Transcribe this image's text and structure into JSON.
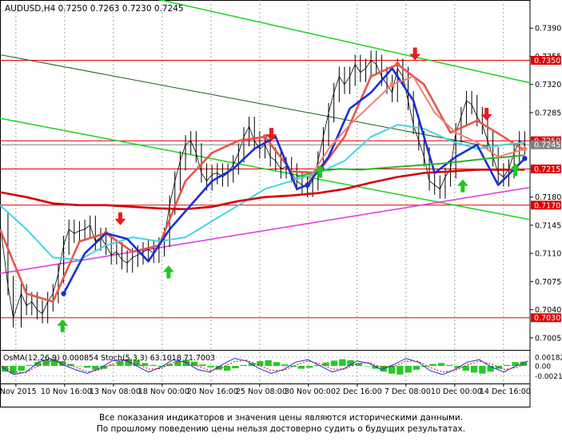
{
  "chart_data": {
    "type": "line",
    "title": "AUDUSD,H4  0.7250 0.7263 0.7230 0.7245",
    "symbol": "AUDUSD,H4",
    "ohlc": [
      "0.7250",
      "0.7263",
      "0.7230",
      "0.7245"
    ],
    "ylim": [
      0.699,
      0.7425
    ],
    "y_ticks": [
      "0.7390",
      "0.7355",
      "0.7320",
      "0.7285",
      "0.7250",
      "0.7215",
      "0.7180",
      "0.7145",
      "0.7110",
      "0.7075",
      "0.7040",
      "0.7005"
    ],
    "x_ticks": [
      "Nov 2015",
      "10 Nov 16:00",
      "13 Nov 08:00",
      "18 Nov 00:00",
      "20 Nov 16:00",
      "25 Nov 08:00",
      "30 Nov 00:00",
      "2 Dec 16:00",
      "7 Dec 08:00",
      "10 Dec 00:00",
      "14 Dec 16:00"
    ],
    "x_range": [
      0,
      100
    ],
    "price_series": {
      "name": "",
      "x": [
        0,
        1.5,
        2.5,
        4,
        5,
        6,
        7,
        8,
        9,
        10,
        11,
        12,
        13,
        14,
        15,
        16,
        17,
        18,
        19,
        20,
        21,
        22,
        23,
        24,
        25,
        26,
        27,
        28,
        29,
        30,
        31,
        32,
        33,
        34,
        35,
        36,
        37,
        38,
        39,
        40,
        41,
        42,
        43,
        44,
        45,
        46,
        47,
        48,
        49,
        50,
        51,
        52,
        53,
        54,
        55,
        56,
        57,
        58,
        59,
        60,
        61,
        62,
        63,
        64,
        65,
        66,
        67,
        68,
        69,
        70,
        71,
        72,
        73,
        74,
        75,
        76,
        77,
        78,
        79,
        80,
        81,
        82,
        83,
        84,
        85,
        86,
        87,
        88,
        89,
        90,
        91,
        92,
        93,
        94,
        95,
        96,
        97,
        98,
        99
      ],
      "y": [
        0.7148,
        0.707,
        0.703,
        0.706,
        0.7045,
        0.705,
        0.704,
        0.7035,
        0.705,
        0.706,
        0.7085,
        0.712,
        0.714,
        0.7135,
        0.7138,
        0.714,
        0.7145,
        0.7125,
        0.713,
        0.712,
        0.7108,
        0.7112,
        0.7102,
        0.7098,
        0.7105,
        0.7108,
        0.7112,
        0.7115,
        0.711,
        0.7118,
        0.713,
        0.717,
        0.72,
        0.7225,
        0.7245,
        0.725,
        0.7235,
        0.721,
        0.72,
        0.7208,
        0.721,
        0.7205,
        0.721,
        0.722,
        0.7235,
        0.7255,
        0.7268,
        0.725,
        0.724,
        0.7245,
        0.723,
        0.7225,
        0.7215,
        0.7218,
        0.721,
        0.72,
        0.7195,
        0.7192,
        0.72,
        0.7225,
        0.7255,
        0.7285,
        0.731,
        0.733,
        0.732,
        0.733,
        0.7345,
        0.7335,
        0.734,
        0.735,
        0.7345,
        0.733,
        0.732,
        0.731,
        0.734,
        0.733,
        0.73,
        0.727,
        0.725,
        0.723,
        0.72,
        0.7195,
        0.719,
        0.7205,
        0.7215,
        0.726,
        0.728,
        0.73,
        0.7295,
        0.728,
        0.727,
        0.725,
        0.723,
        0.721,
        0.7205,
        0.7215,
        0.7235,
        0.725,
        0.7245
      ],
      "color": "#000000"
    },
    "series": [
      {
        "name": "",
        "color": "#e8554a",
        "values_x": [
          0,
          5,
          10,
          15,
          20,
          25,
          30,
          35,
          40,
          45,
          50,
          55,
          60,
          65,
          70,
          75,
          80,
          85,
          90,
          95,
          99
        ],
        "values": [
          0.714,
          0.706,
          0.705,
          0.7125,
          0.7135,
          0.7112,
          0.712,
          0.72,
          0.7235,
          0.725,
          0.7255,
          0.7212,
          0.721,
          0.7255,
          0.733,
          0.7345,
          0.732,
          0.726,
          0.7275,
          0.7255,
          0.7238
        ]
      },
      {
        "name": "",
        "color": "#46d4e0",
        "values_x": [
          0,
          5,
          10,
          15,
          20,
          25,
          30,
          35,
          40,
          45,
          50,
          55,
          60,
          65,
          70,
          75,
          80,
          85,
          90,
          95,
          99
        ],
        "values": [
          0.717,
          0.714,
          0.7105,
          0.7102,
          0.712,
          0.713,
          0.7125,
          0.713,
          0.715,
          0.717,
          0.719,
          0.72,
          0.721,
          0.7225,
          0.7255,
          0.727,
          0.7265,
          0.725,
          0.724,
          0.7245,
          0.7248
        ]
      },
      {
        "name": "",
        "color": "#d40000",
        "values_x": [
          0,
          5,
          10,
          15,
          20,
          25,
          30,
          35,
          40,
          45,
          50,
          55,
          60,
          65,
          70,
          75,
          80,
          85,
          90,
          95,
          99
        ],
        "values": [
          0.7186,
          0.718,
          0.7172,
          0.717,
          0.717,
          0.7168,
          0.7166,
          0.7165,
          0.7168,
          0.7175,
          0.718,
          0.7182,
          0.7185,
          0.719,
          0.7198,
          0.7205,
          0.721,
          0.7212,
          0.7214,
          0.7214,
          0.7214
        ]
      },
      {
        "name": "",
        "color": "#1a2fd0",
        "values_x": [
          12,
          16,
          20,
          24,
          28,
          32,
          36,
          40,
          44,
          48,
          52,
          56,
          58
        ],
        "values": [
          0.706,
          0.711,
          0.7135,
          0.7128,
          0.71,
          0.714,
          0.717,
          0.72,
          0.7215,
          0.724,
          0.7255,
          0.719,
          0.7195
        ]
      },
      {
        "name": "",
        "color": "#1a2fd0",
        "values_x": [
          58,
          62,
          66,
          70,
          74,
          78,
          82,
          86,
          90,
          94,
          99
        ],
        "values": [
          0.7195,
          0.723,
          0.729,
          0.731,
          0.734,
          0.73,
          0.721,
          0.723,
          0.7245,
          0.7195,
          0.7228
        ]
      },
      {
        "name": "",
        "color": "#28b428",
        "values_x": [
          56,
          60,
          64,
          68,
          72,
          76,
          80,
          84,
          88,
          92,
          96,
          99
        ],
        "values": [
          0.7205,
          0.7212,
          0.7215,
          0.7214,
          0.7216,
          0.7218,
          0.722,
          0.7222,
          0.7225,
          0.7228,
          0.723,
          0.7232
        ]
      },
      {
        "name": "",
        "color": "#f08070",
        "values_x": [
          58,
          62,
          66,
          70,
          74,
          78,
          82,
          86,
          90,
          94,
          99
        ],
        "values": [
          0.72,
          0.724,
          0.727,
          0.7295,
          0.732,
          0.733,
          0.7285,
          0.726,
          0.7248,
          0.723,
          0.724
        ]
      }
    ],
    "trend_lines": [
      {
        "name": "",
        "color": "#28d228",
        "from": [
          27,
          0.743
        ],
        "to": [
          100,
          0.7322
        ]
      },
      {
        "name": "",
        "color": "#28d228",
        "from": [
          0,
          0.7278
        ],
        "to": [
          100,
          0.7152
        ]
      },
      {
        "name": "",
        "color": "#1a5c1a",
        "from": [
          0,
          0.7357
        ],
        "to": [
          92,
          0.7243
        ]
      },
      {
        "name": "",
        "color": "#e040e0",
        "from": [
          0,
          0.7085
        ],
        "to": [
          100,
          0.7192
        ]
      }
    ],
    "horizontal_levels": [
      {
        "label": "0.7350",
        "value": 0.735,
        "color": "#e00000"
      },
      {
        "label": "0.7250",
        "value": 0.725,
        "color": "#e00000"
      },
      {
        "label": "0.7245",
        "value": 0.7245,
        "color": "#808080"
      },
      {
        "label": "0.7215",
        "value": 0.7215,
        "color": "#e00000"
      },
      {
        "label": "0.7170",
        "value": 0.717,
        "color": "#e00000"
      },
      {
        "label": "0.7030",
        "value": 0.703,
        "color": "#e00000"
      }
    ],
    "signals": [
      {
        "direction": "up",
        "x": 11.8,
        "price": 0.7018
      },
      {
        "direction": "down",
        "x": 22.7,
        "price": 0.7155
      },
      {
        "direction": "up",
        "x": 31.8,
        "price": 0.7085
      },
      {
        "direction": "down",
        "x": 51.2,
        "price": 0.726
      },
      {
        "direction": "up",
        "x": 60.4,
        "price": 0.721
      },
      {
        "direction": "down",
        "x": 78.3,
        "price": 0.736
      },
      {
        "direction": "up",
        "x": 87.3,
        "price": 0.7192
      },
      {
        "direction": "down",
        "x": 91.8,
        "price": 0.7285
      },
      {
        "direction": "up",
        "x": 97.2,
        "price": 0.7212
      }
    ],
    "indicator_panel": {
      "label": "OsMA(12,26,9) 0.000854  Stoch(5,3,3) 63.1018 71.7003",
      "y_ticks": [
        "0.00182",
        "0.00",
        "-0.00212"
      ],
      "ylim": [
        -0.0035,
        0.003
      ],
      "bars": [
        -0.0012,
        -0.0016,
        -0.001,
        0.0002,
        0.0008,
        0.0012,
        0.0014,
        0.001,
        0.0004,
        0.0,
        -0.0004,
        -0.0008,
        -0.0006,
        0.0002,
        0.001,
        0.0014,
        0.0012,
        0.0006,
        0.0002,
        -0.0002,
        0.0004,
        0.001,
        0.0013,
        0.0009,
        0.0003,
        -0.0003,
        -0.0008,
        -0.001,
        -0.0005,
        0.0002,
        0.0006,
        0.001,
        0.0012,
        0.0008,
        0.0003,
        -0.0002,
        -0.0006,
        -0.0004,
        0.0002,
        0.0007,
        0.0011,
        0.0014,
        0.0012,
        0.0006,
        0.0,
        -0.0006,
        -0.0012,
        -0.0016,
        -0.0018,
        -0.0014,
        -0.0008,
        -0.0002,
        0.0004,
        0.0006,
        0.0002,
        -0.0004,
        -0.001,
        -0.0014,
        -0.0016,
        -0.0012,
        -0.0006,
        0.0002,
        0.0008,
        0.0009
      ],
      "stoch_main": [
        50,
        20,
        30,
        70,
        85,
        60,
        40,
        25,
        45,
        75,
        80,
        55,
        30,
        50,
        80,
        70,
        40,
        30,
        60,
        85,
        75,
        45,
        25,
        40,
        70,
        80,
        55,
        30,
        45,
        75,
        65,
        40,
        60,
        85,
        70,
        35,
        20,
        40,
        70,
        80,
        50,
        30,
        55,
        75
      ],
      "stoch_signal": [
        55,
        30,
        28,
        55,
        75,
        70,
        50,
        32,
        38,
        62,
        78,
        65,
        42,
        44,
        68,
        74,
        55,
        36,
        48,
        72,
        78,
        58,
        36,
        36,
        58,
        74,
        64,
        42,
        42,
        64,
        68,
        50,
        52,
        74,
        74,
        48,
        30,
        36,
        58,
        74,
        62,
        40,
        48,
        66
      ],
      "stoch_main_color": "#1a2fd0",
      "stoch_signal_color": "#e00000",
      "bar_color": "#28c828"
    }
  },
  "disclaimer": {
    "line1": "Все показания индикаторов и значения цены являются историческими данными.",
    "line2": "По прошлому поведению цены нельзя достоверно судить о будущих результатах."
  }
}
